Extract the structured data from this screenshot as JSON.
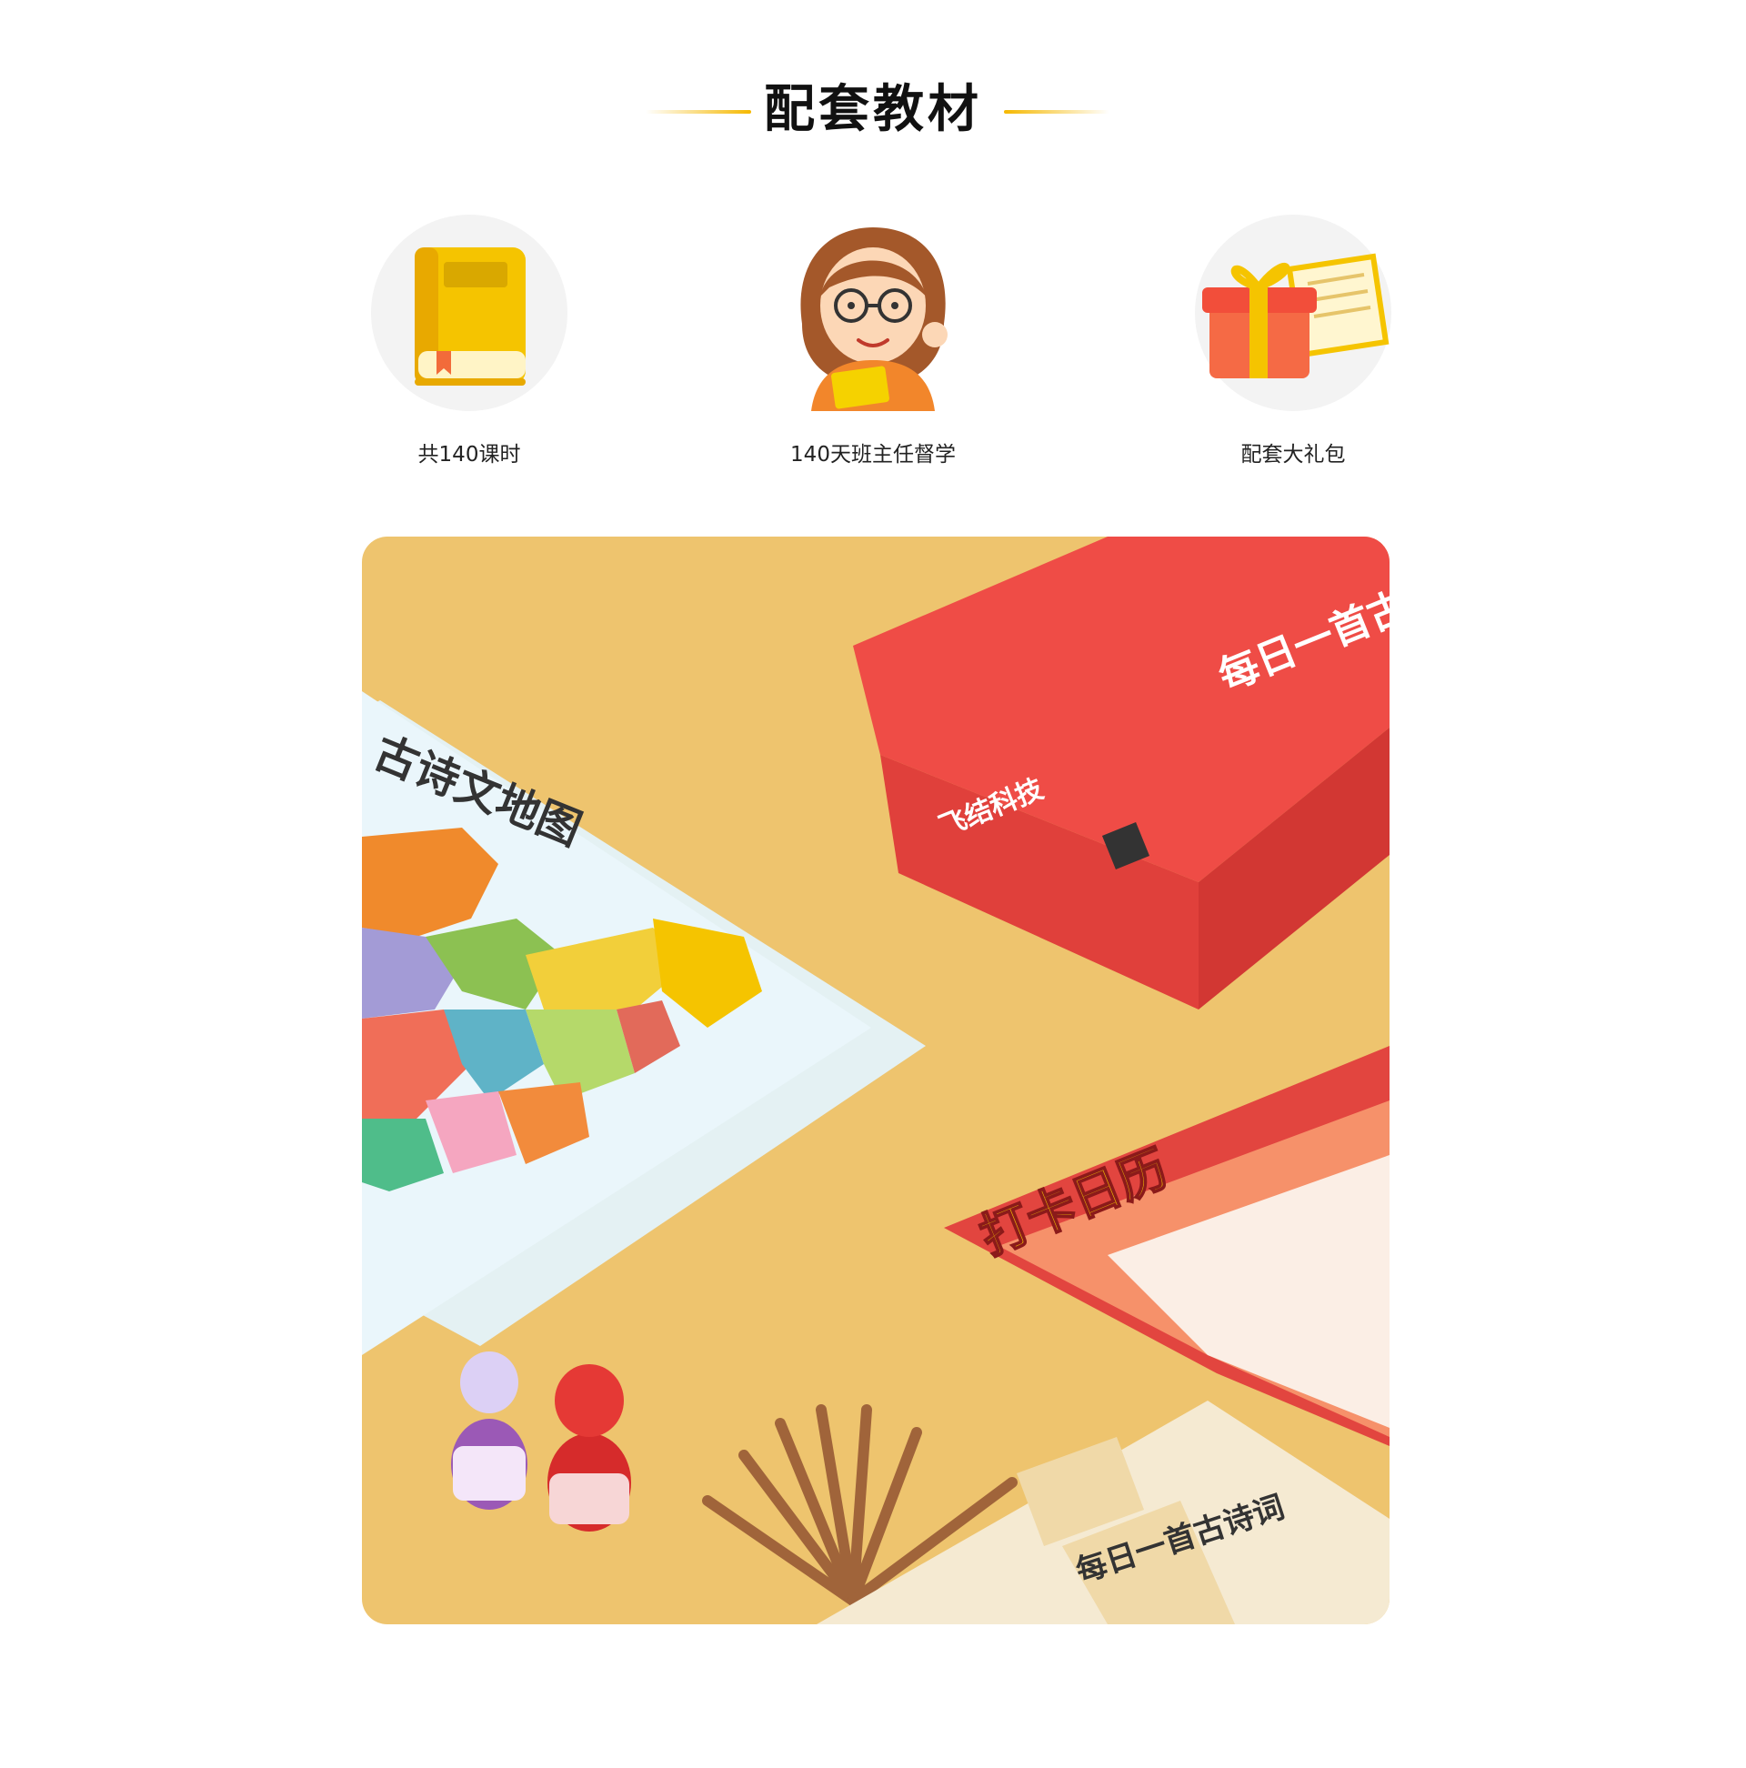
{
  "section": {
    "title": "配套教材"
  },
  "features": [
    {
      "label": "共140课时",
      "icon": "book-icon"
    },
    {
      "label": "140天班主任督学",
      "icon": "teacher-icon"
    },
    {
      "label": "配套大礼包",
      "icon": "gift-icon"
    }
  ],
  "photo": {
    "map_title": "古诗文地图",
    "box_title": "每日一首古诗词",
    "brand": "飞结科技",
    "calendar_title": "打卡日历",
    "booklet_title": "每日一首古诗词",
    "colors": {
      "background": "#eec46e",
      "box": "#ee4a44",
      "accent": "#f5b800"
    }
  }
}
